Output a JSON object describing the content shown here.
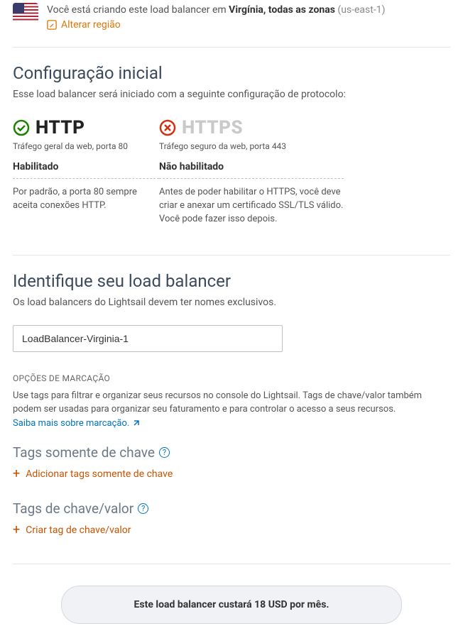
{
  "region": {
    "prefix": "Você está criando este load balancer em ",
    "name": "Virgínia, todas as zonas",
    "code": "(us-east-1)",
    "change_label": "Alterar região"
  },
  "config": {
    "title": "Configuração inicial",
    "subtitle": "Esse load balancer será iniciado com a seguinte configuração de protocolo:",
    "http": {
      "name": "HTTP",
      "caption": "Tráfego geral da web, porta 80",
      "status": "Habilitado",
      "desc": "Por padrão, a porta 80 sempre aceita conexões HTTP."
    },
    "https": {
      "name": "HTTPS",
      "caption": "Tráfego seguro da web, porta 443",
      "status": "Não habilitado",
      "desc1": "Antes de poder habilitar o HTTPS, você deve criar e anexar um certificado SSL/TLS válido.",
      "desc2": "Você pode fazer isso depois."
    }
  },
  "identify": {
    "title": "Identifique seu load balancer",
    "subtitle": "Os load balancers do Lightsail devem ter nomes exclusivos.",
    "value": "LoadBalancer-Virginia-1"
  },
  "tagging": {
    "options_heading": "OPÇÕES DE MARCAÇÃO",
    "desc_prefix": "Use tags para filtrar e organizar seus recursos no console do Lightsail. Tags de chave/valor também podem ser usadas para organizar seu faturamento e para controlar o acesso a seus recursos. ",
    "learn_more": "Saiba mais sobre marcação.",
    "key_only_title": "Tags somente de chave",
    "key_only_add": "Adicionar tags somente de chave",
    "kv_title": "Tags de chave/valor",
    "kv_add": "Criar tag de chave/valor"
  },
  "cost": {
    "text": "Este load balancer custará 18 USD por mês."
  }
}
